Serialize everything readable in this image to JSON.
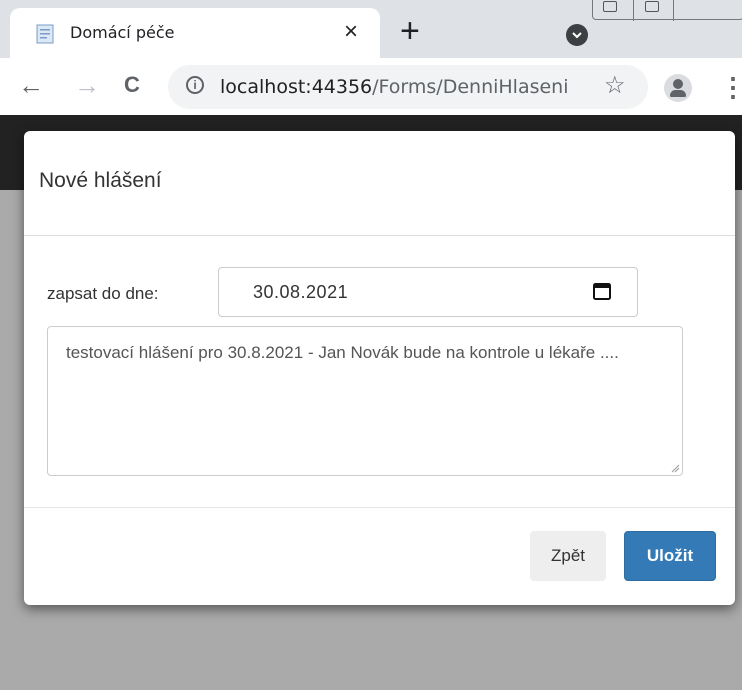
{
  "browser": {
    "tab_title": "Domácí péče",
    "tab_close": "×",
    "new_tab": "+",
    "url_host": "localhost:44356",
    "url_path": "/Forms/DenniHlaseni",
    "info_icon": "i",
    "star": "☆",
    "menu": "⋮",
    "back": "←",
    "forward": "→",
    "reload": "C"
  },
  "modal": {
    "title": "Nové hlášení",
    "date_label": "zapsat do dne:",
    "date_value": "30.08.2021",
    "note_text": "testovací hlášení pro 30.8.2021 - Jan Novák bude na kontrole u lékaře ....",
    "back_button": "Zpět",
    "save_button": "Uložit"
  },
  "icons": {
    "favicon": "document-icon",
    "tab_search": "tab-search-icon",
    "calendar": "calendar-icon",
    "profile": "profile-icon"
  },
  "colors": {
    "primary": "#337ab7",
    "navbar": "#222222",
    "overlay": "#aaaaaa"
  }
}
